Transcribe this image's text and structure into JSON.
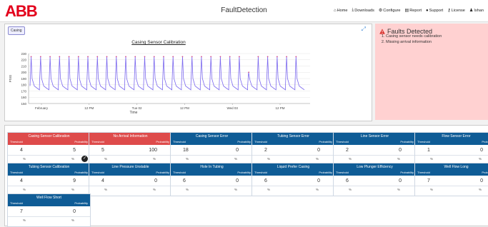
{
  "app": {
    "logo": "ABB",
    "title": "FaultDetection"
  },
  "nav": [
    {
      "icon": "home-icon",
      "glyph": "⌂",
      "label": "Home"
    },
    {
      "icon": "download-icon",
      "glyph": "⤓",
      "label": "Downloads"
    },
    {
      "icon": "gear-icon",
      "glyph": "⚙",
      "label": "Configure"
    },
    {
      "icon": "report-icon",
      "glyph": "▤",
      "label": "Report"
    },
    {
      "icon": "support-icon",
      "glyph": "●",
      "label": "Support"
    },
    {
      "icon": "key-icon",
      "glyph": "⚷",
      "label": "License"
    },
    {
      "icon": "user-icon",
      "glyph": "♟",
      "label": "Ishan"
    }
  ],
  "chart_panel": {
    "tag": "Casing"
  },
  "chart_data": {
    "type": "line",
    "title": "Casing Sensor Calibration",
    "ylabel": "PSIG",
    "xlabel": "Time",
    "ylim": [
      150,
      230
    ],
    "yticks": [
      150,
      160,
      170,
      180,
      190,
      200,
      210,
      220,
      230
    ],
    "xticks": [
      "February",
      "12 PM",
      "Tue 02",
      "12 PM",
      "Wed 03",
      "12 PM"
    ],
    "series": [
      {
        "pattern": "sawtooth",
        "cycles": 29,
        "high": 225,
        "low": 172,
        "color": "#7b68ee"
      }
    ],
    "anomaly_near_tick": "Wed 03"
  },
  "faults": {
    "title": "Faults Detected",
    "items": [
      "Casing sensor needs calibration",
      "Missing arrival information"
    ]
  },
  "cards_common": {
    "threshold": "Threshold",
    "probability": "Probability",
    "unit": "%"
  },
  "cards": [
    {
      "name": "Casing Sensor Calibration",
      "threshold": "4",
      "probability": "5",
      "alert": true,
      "checked": true
    },
    {
      "name": "No Arrival Information",
      "threshold": "5",
      "probability": "100",
      "alert": true,
      "checked": false
    },
    {
      "name": "Casing Sensor Error",
      "threshold": "18",
      "probability": "0",
      "alert": false,
      "checked": false
    },
    {
      "name": "Tubing Sensor Error",
      "threshold": "2",
      "probability": "0",
      "alert": false,
      "checked": false
    },
    {
      "name": "Line Sensor Error",
      "threshold": "2",
      "probability": "0",
      "alert": false,
      "checked": false
    },
    {
      "name": "Flow Sensor Error",
      "threshold": "1",
      "probability": "0",
      "alert": false,
      "checked": false
    },
    {
      "name": "Tubing Sensor Calibration",
      "threshold": "4",
      "probability": "9",
      "alert": false,
      "checked": false
    },
    {
      "name": "Line Pressure Unstable",
      "threshold": "4",
      "probability": "0",
      "alert": false,
      "checked": false
    },
    {
      "name": "Hole In Tubing",
      "threshold": "6",
      "probability": "0",
      "alert": false,
      "checked": false
    },
    {
      "name": "Liquid Prefer Casing",
      "threshold": "6",
      "probability": "0",
      "alert": false,
      "checked": false
    },
    {
      "name": "Low Plunger Efficiency",
      "threshold": "6",
      "probability": "0",
      "alert": false,
      "checked": false
    },
    {
      "name": "Well Flow Long",
      "threshold": "7",
      "probability": "0",
      "alert": false,
      "checked": false
    },
    {
      "name": "Well Flow Short",
      "threshold": "7",
      "probability": "0",
      "alert": false,
      "checked": false
    }
  ],
  "colors": {
    "brand_red": "#e3001b",
    "card_blue": "#0f5c96",
    "card_red": "#de4b4b",
    "fault_bg": "#ffd1d1"
  }
}
